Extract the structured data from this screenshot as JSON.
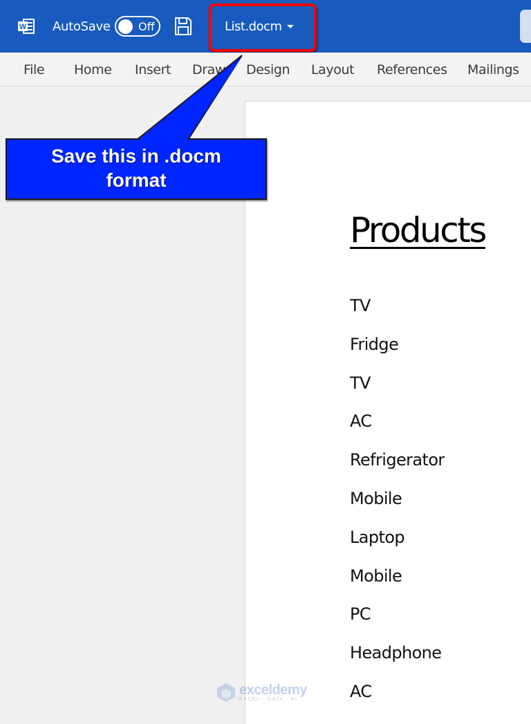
{
  "titlebar": {
    "app_icon": "word-app-icon",
    "autosave_label": "AutoSave",
    "autosave_state": "Off",
    "save_icon": "save-floppy-icon",
    "filename": "List.docm",
    "filename_menu_icon": "caret-down-icon",
    "background_color": "#185abd"
  },
  "ribbon": {
    "tabs": [
      {
        "label": "File"
      },
      {
        "label": "Home"
      },
      {
        "label": "Insert"
      },
      {
        "label": "Draw"
      },
      {
        "label": "Design"
      },
      {
        "label": "Layout"
      },
      {
        "label": "References"
      },
      {
        "label": "Mailings"
      }
    ]
  },
  "document": {
    "heading": "Products",
    "items": [
      "TV",
      "Fridge",
      "TV",
      "AC",
      "Refrigerator",
      "Mobile",
      "Laptop",
      "Mobile",
      "PC",
      "Headphone",
      "AC"
    ]
  },
  "annotation": {
    "callout_text": "Save this in .docm format",
    "callout_color": "#0026ff",
    "highlight_color": "#ff0000"
  },
  "watermark": {
    "name": "exceldemy",
    "tagline": "EXCEL · DATA · BI"
  }
}
